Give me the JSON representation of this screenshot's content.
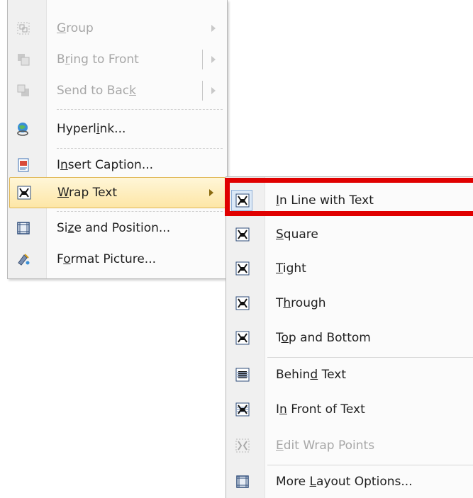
{
  "context_menu": {
    "items": [
      {
        "label": "Group",
        "underline": "G",
        "icon": "group-icon",
        "disabled": true,
        "submenu": true
      },
      {
        "label": "Bring to Front",
        "underline": "r",
        "icon": "bring-to-front-icon",
        "disabled": true,
        "submenu": true,
        "split": true
      },
      {
        "label": "Send to Back",
        "underline": "k",
        "icon": "send-to-back-icon",
        "disabled": true,
        "submenu": true,
        "split": true
      },
      {
        "label": "Hyperlink...",
        "underline": "i",
        "icon": "hyperlink-icon",
        "disabled": false
      },
      {
        "label": "Insert Caption...",
        "underline": "n",
        "icon": "insert-caption-icon",
        "disabled": false
      },
      {
        "label": "Wrap Text",
        "underline": "W",
        "icon": "wrap-text-icon",
        "disabled": false,
        "submenu": true,
        "highlighted": true
      },
      {
        "label": "Size and Position...",
        "underline": "z",
        "icon": "size-position-icon",
        "disabled": false
      },
      {
        "label": "Format Picture...",
        "underline": "o",
        "icon": "format-picture-icon",
        "disabled": false
      }
    ]
  },
  "wrap_submenu": {
    "items": [
      {
        "label": "In Line with Text",
        "underline": "I",
        "icon": "inline-with-text-icon",
        "checked": true
      },
      {
        "label": "Square",
        "underline": "S",
        "icon": "square-wrap-icon"
      },
      {
        "label": "Tight",
        "underline": "T",
        "icon": "tight-wrap-icon"
      },
      {
        "label": "Through",
        "underline": "h",
        "icon": "through-wrap-icon"
      },
      {
        "label": "Top and Bottom",
        "underline": "o",
        "icon": "top-bottom-wrap-icon"
      },
      {
        "label": "Behind Text",
        "underline": "d",
        "icon": "behind-text-icon"
      },
      {
        "label": "In Front of Text",
        "underline": "n",
        "icon": "in-front-of-text-icon"
      },
      {
        "label": "Edit Wrap Points",
        "underline": "E",
        "icon": "edit-wrap-points-icon",
        "disabled": true
      },
      {
        "label": "More Layout Options...",
        "underline": "L",
        "icon": "more-layout-options-icon"
      }
    ]
  },
  "colors": {
    "highlight_border": "#e00000",
    "hover_bg": "#fde6a6",
    "disabled_text": "#a7a7a7"
  }
}
